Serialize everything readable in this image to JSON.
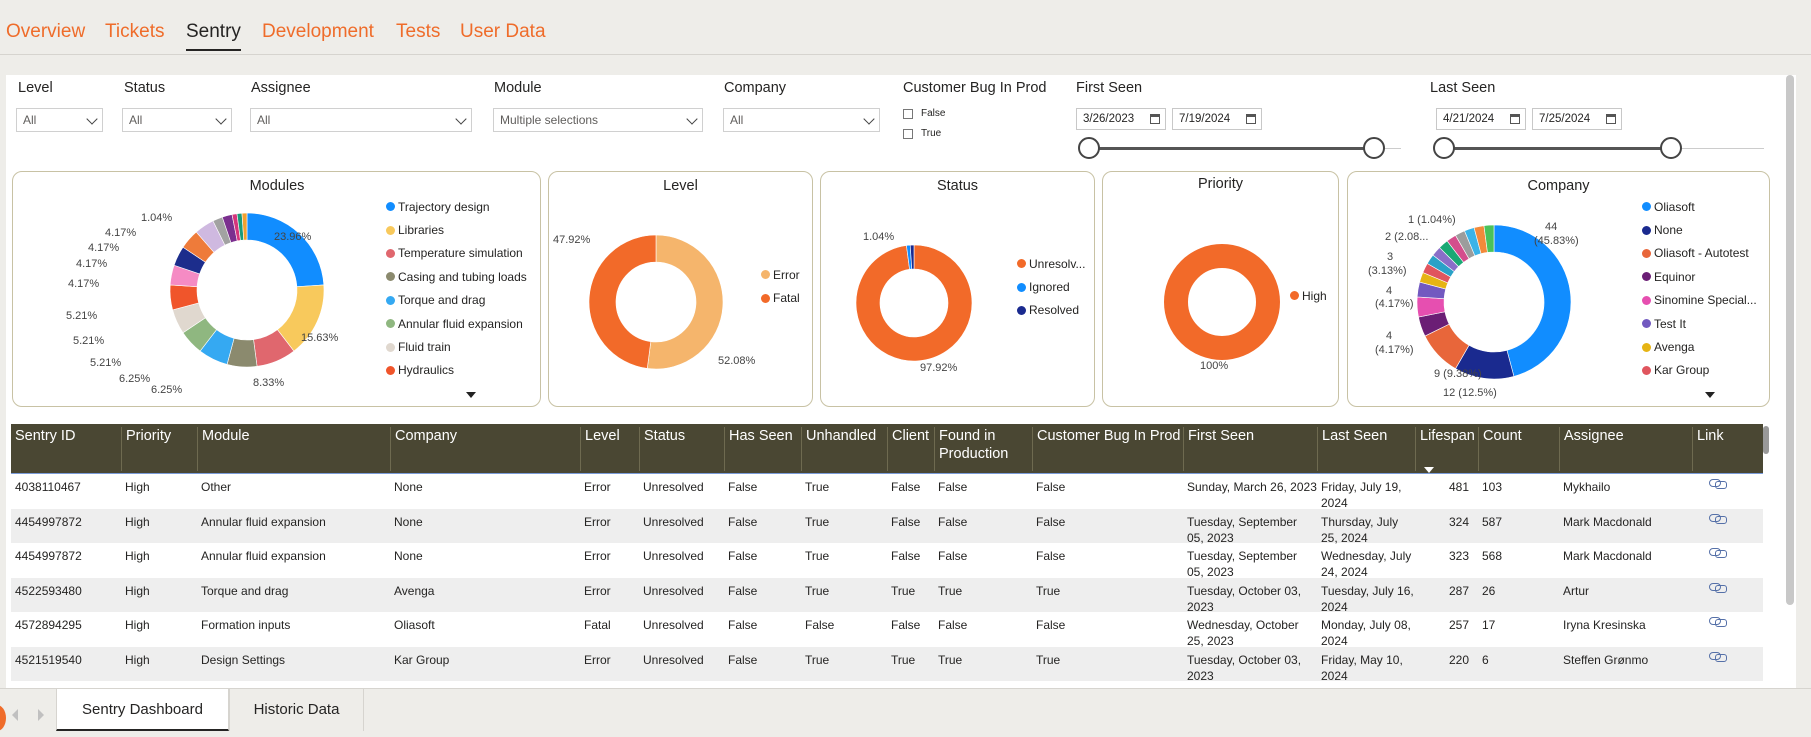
{
  "nav": {
    "tabs": [
      {
        "label": "Overview"
      },
      {
        "label": "Tickets"
      },
      {
        "label": "Sentry"
      },
      {
        "label": "Development"
      },
      {
        "label": "Tests"
      },
      {
        "label": "User Data"
      }
    ],
    "active": "Sentry"
  },
  "slicers": {
    "level": {
      "label": "Level",
      "value": "All"
    },
    "status": {
      "label": "Status",
      "value": "All"
    },
    "assignee": {
      "label": "Assignee",
      "value": "All"
    },
    "module": {
      "label": "Module",
      "value": "Multiple selections"
    },
    "company": {
      "label": "Company",
      "value": "All"
    },
    "customer_bug": {
      "label": "Customer Bug In Prod",
      "options": [
        "False",
        "True"
      ]
    },
    "first_seen": {
      "label": "First Seen",
      "from": "3/26/2023",
      "to": "7/19/2024"
    },
    "last_seen": {
      "label": "Last Seen",
      "from": "4/21/2024",
      "to": "7/25/2024"
    }
  },
  "cards": {
    "modules": {
      "title": "Modules",
      "legend": [
        "Trajectory design",
        "Libraries",
        "Temperature simulation",
        "Casing and tubing loads",
        "Torque and drag",
        "Annular fluid expansion",
        "Fluid train",
        "Hydraulics"
      ],
      "labels": [
        "23.96%",
        "15.63%",
        "8.33%",
        "6.25%",
        "6.25%",
        "5.21%",
        "5.21%",
        "5.21%",
        "4.17%",
        "4.17%",
        "4.17%",
        "4.17%",
        "1.04%"
      ]
    },
    "level": {
      "title": "Level",
      "legend": [
        "Error",
        "Fatal"
      ],
      "labels": [
        "47.92%",
        "52.08%"
      ]
    },
    "status": {
      "title": "Status",
      "legend": [
        "Unresolv...",
        "Ignored",
        "Resolved"
      ],
      "labels": [
        "1.04%",
        "97.92%"
      ]
    },
    "priority": {
      "title": "Priority",
      "legend": [
        "High"
      ],
      "labels": [
        "100%"
      ]
    },
    "company": {
      "title": "Company",
      "legend": [
        "Oliasoft",
        "None",
        "Oliasoft - Autotest",
        "Equinor",
        "Sinomine Special...",
        "Test It",
        "Avenga",
        "Kar Group"
      ],
      "labels": [
        "44",
        "(45.83%)",
        "12 (12.5%)",
        "9 (9.38%)",
        "4",
        "(4.17%)",
        "4",
        "(4.17%)",
        "3",
        "(3.13%)",
        "2 (2.08...",
        "1 (1.04%)"
      ]
    }
  },
  "chart_data": [
    {
      "type": "pie",
      "title": "Modules",
      "categories": [
        "Trajectory design",
        "Libraries",
        "Temperature simulation",
        "Casing and tubing loads",
        "Torque and drag",
        "Annular fluid expansion",
        "Fluid train",
        "Hydraulics",
        "",
        "",
        "",
        "",
        "",
        "",
        "",
        "",
        ""
      ],
      "values": [
        23.96,
        15.63,
        8.33,
        6.25,
        6.25,
        5.21,
        5.21,
        5.21,
        4.17,
        4.17,
        4.17,
        4.17,
        2.08,
        2.08,
        1.04,
        1.04,
        1.04
      ],
      "colors": [
        "#118dff",
        "#f8c95c",
        "#e0676e",
        "#8b8a6e",
        "#35a9f2",
        "#8fb780",
        "#e0d8cf",
        "#f0552b",
        "#f58bc4",
        "#1c2d8c",
        "#ee7b3a",
        "#cfb9e0",
        "#a2a2a2",
        "#7b2f8f",
        "#d6357c",
        "#1a9b7a",
        "#f0a030"
      ]
    },
    {
      "type": "pie",
      "title": "Level",
      "categories": [
        "Error",
        "Fatal"
      ],
      "values": [
        52.08,
        47.92
      ],
      "colors": [
        "#f5b56c",
        "#f26a29"
      ]
    },
    {
      "type": "pie",
      "title": "Status",
      "categories": [
        "Unresolv...",
        "Ignored",
        "Resolved"
      ],
      "values": [
        97.92,
        1.04,
        1.04
      ],
      "colors": [
        "#f26a29",
        "#118dff",
        "#1a2a8f"
      ]
    },
    {
      "type": "pie",
      "title": "Priority",
      "categories": [
        "High"
      ],
      "values": [
        100
      ],
      "colors": [
        "#f26a29"
      ]
    },
    {
      "type": "pie",
      "title": "Company",
      "categories": [
        "Oliasoft",
        "None",
        "Oliasoft - Autotest",
        "Equinor",
        "Sinomine Special...",
        "Test It",
        "Avenga",
        "Kar Group",
        "",
        "",
        "",
        "",
        "",
        "",
        "",
        ""
      ],
      "values": [
        44,
        12,
        9,
        4,
        4,
        3,
        2,
        2,
        2,
        2,
        2,
        2,
        2,
        2,
        2,
        2
      ],
      "colors": [
        "#118dff",
        "#1a2a8f",
        "#e8663a",
        "#6b1e75",
        "#e64fb0",
        "#7259c0",
        "#e6b414",
        "#e0555e",
        "#2aa1c7",
        "#8a6ec8",
        "#1aa874",
        "#d44e8c",
        "#9c9c9c",
        "#3ab3e8",
        "#f28a3a",
        "#4ac25a"
      ]
    }
  ],
  "table": {
    "headers": [
      "Sentry ID",
      "Priority",
      "Module",
      "Company",
      "Level",
      "Status",
      "Has Seen",
      "Unhandled",
      "Client",
      "Found in Production",
      "Customer Bug In Prod",
      "First Seen",
      "Last Seen",
      "Lifespan",
      "Count",
      "Assignee",
      "Link"
    ],
    "rows": [
      [
        "4038110467",
        "High",
        "Other",
        "None",
        "Error",
        "Unresolved",
        "False",
        "True",
        "False",
        "False",
        "False",
        "Sunday, March 26, 2023",
        "Friday, July 19, 2024",
        "481",
        "103",
        "Mykhailo"
      ],
      [
        "4454997872",
        "High",
        "Annular fluid expansion",
        "None",
        "Error",
        "Unresolved",
        "False",
        "True",
        "False",
        "False",
        "False",
        "Tuesday, September 05, 2023",
        "Thursday, July 25, 2024",
        "324",
        "587",
        "Mark Macdonald"
      ],
      [
        "4454997872",
        "High",
        "Annular fluid expansion",
        "None",
        "Error",
        "Unresolved",
        "False",
        "True",
        "False",
        "False",
        "False",
        "Tuesday, September 05, 2023",
        "Wednesday, July 24, 2024",
        "323",
        "568",
        "Mark Macdonald"
      ],
      [
        "4522593480",
        "High",
        "Torque and drag",
        "Avenga",
        "Error",
        "Unresolved",
        "False",
        "True",
        "True",
        "True",
        "True",
        "Tuesday, October 03, 2023",
        "Tuesday, July 16, 2024",
        "287",
        "26",
        "Artur"
      ],
      [
        "4572894295",
        "High",
        "Formation inputs",
        "Oliasoft",
        "Fatal",
        "Unresolved",
        "False",
        "False",
        "False",
        "False",
        "False",
        "Wednesday, October 25, 2023",
        "Monday, July 08, 2024",
        "257",
        "17",
        "Iryna Kresinska"
      ],
      [
        "4521519540",
        "High",
        "Design Settings",
        "Kar Group",
        "Error",
        "Unresolved",
        "False",
        "True",
        "True",
        "True",
        "True",
        "Tuesday, October 03, 2023",
        "Friday, May 10, 2024",
        "220",
        "6",
        "Steffen Grønmo"
      ]
    ]
  },
  "bottom": {
    "pages": [
      "Sentry Dashboard",
      "Historic Data"
    ],
    "active": "Sentry Dashboard"
  }
}
